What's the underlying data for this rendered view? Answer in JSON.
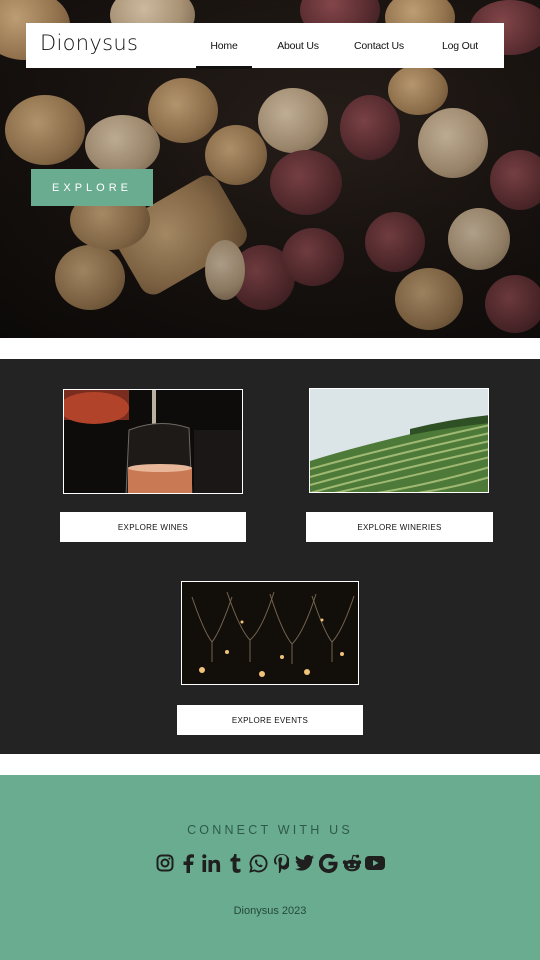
{
  "header": {
    "brand": "Dionysus",
    "nav": [
      {
        "label": "Home",
        "active": true
      },
      {
        "label": "About Us"
      },
      {
        "label": "Contact Us"
      },
      {
        "label": "Log Out"
      }
    ]
  },
  "hero": {
    "explore_label": "EXPLORE"
  },
  "cards": [
    {
      "label": "EXPLORE WINES",
      "image": "wine-pour-photo"
    },
    {
      "label": "EXPLORE WINERIES",
      "image": "vineyard-photo"
    },
    {
      "label": "EXPLORE EVENTS",
      "image": "wine-glasses-photo"
    }
  ],
  "footer": {
    "connect": "CONNECT WITH US",
    "social": [
      "instagram-icon",
      "facebook-icon",
      "linkedin-icon",
      "tumblr-icon",
      "whatsapp-icon",
      "pinterest-icon",
      "twitter-icon",
      "google-icon",
      "reddit-icon",
      "youtube-icon"
    ],
    "copyright": "Dionysus 2023"
  },
  "colors": {
    "accent": "#6aac90",
    "dark_bg": "#232323",
    "footer_text": "#2e5b49"
  }
}
